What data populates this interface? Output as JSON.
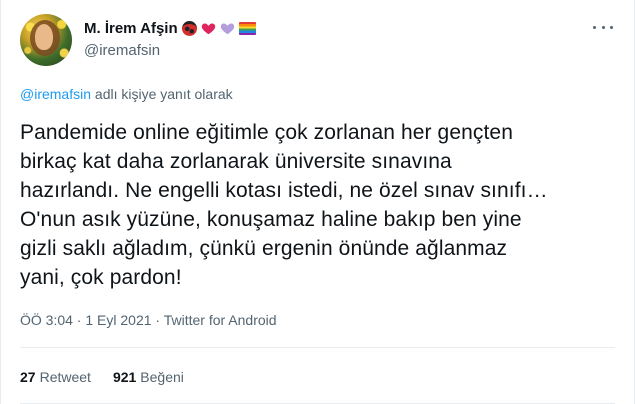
{
  "author": {
    "display_name": "M. İrem Afşin",
    "handle": "@iremafsin",
    "emojis": [
      "ladybug-icon",
      "red-heart-icon",
      "purple-heart-icon",
      "rainbow-flag-icon"
    ]
  },
  "reply_context": {
    "mention": "@iremafsin",
    "suffix": " adlı kişiye yanıt olarak"
  },
  "tweet": {
    "lines": [
      "Pandemide online eğitimle çok zorlanan her gençten",
      "birkaç kat daha zorlanarak üniversite sınavına",
      "hazırlandı. Ne engelli kotası istedi, ne özel sınav sınıfı…",
      "O'nun asık yüzüne, konuşamaz haline bakıp ben yine",
      "gizli saklı ağladım, çünkü ergenin önünde ağlanmaz",
      "yani, çok pardon!"
    ],
    "meta": "ÖÖ 3:04 · 1 Eyl 2021 · Twitter for Android"
  },
  "stats": {
    "retweets_count": "27",
    "retweets_label": "Retweet",
    "likes_count": "921",
    "likes_label": "Beğeni"
  },
  "colors": {
    "accent": "#1d9bf0",
    "text": "#0f1419",
    "secondary": "#536471",
    "divider": "#e6ecf0"
  }
}
